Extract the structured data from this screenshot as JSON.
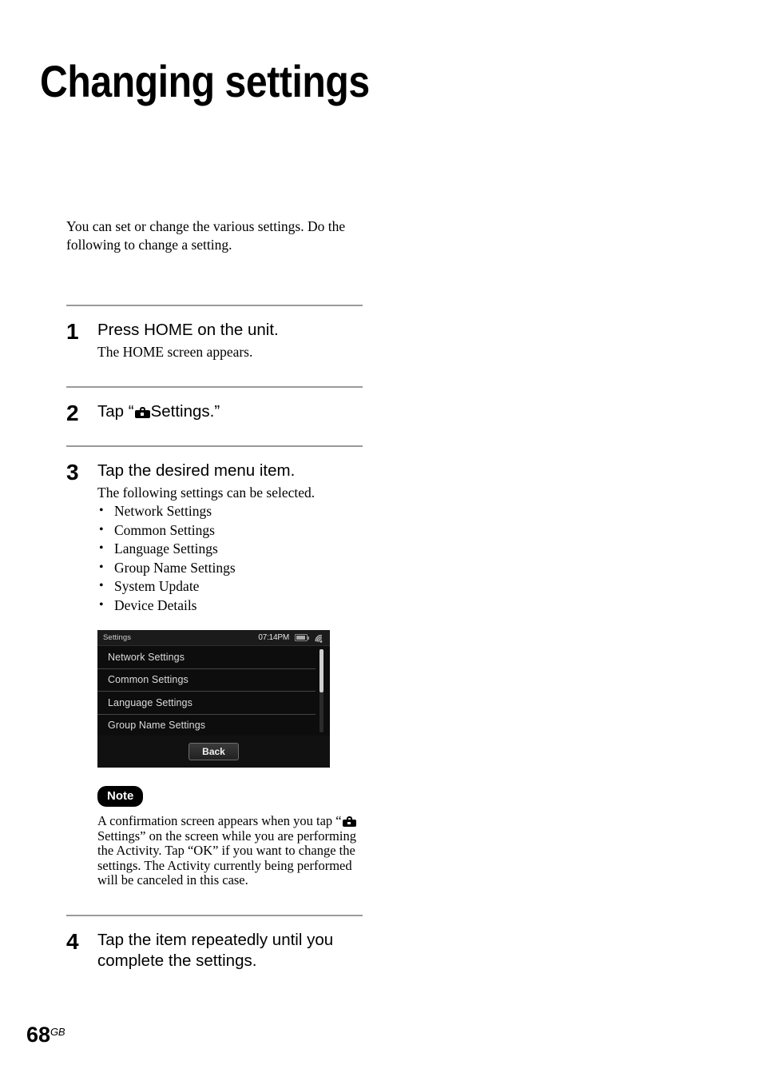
{
  "document": {
    "title": "Changing settings",
    "intro": "You can set or change the various settings. Do the following to change a setting.",
    "page_number": "68",
    "page_number_suffix": "GB"
  },
  "steps": [
    {
      "number": "1",
      "heading": "Press HOME on the unit.",
      "body": "The HOME screen appears."
    },
    {
      "number": "2",
      "heading_prefix": "Tap “",
      "heading_icon": "toolbox-icon",
      "heading_suffix": "Settings.”"
    },
    {
      "number": "3",
      "heading": "Tap the desired menu item.",
      "body": "The following settings can be selected.",
      "bullets": [
        "Network Settings",
        "Common Settings",
        "Language Settings",
        "Group Name Settings",
        "System Update",
        "Device Details"
      ]
    },
    {
      "number": "4",
      "heading": "Tap the item repeatedly until you complete the settings."
    }
  ],
  "device_screen": {
    "status_title": "Settings",
    "clock": "07:14PM",
    "battery_icon": "battery-icon",
    "wifi_icon": "wifi-signal-icon",
    "menu_items": [
      "Network Settings",
      "Common Settings",
      "Language Settings",
      "Group Name Settings"
    ],
    "back_label": "Back"
  },
  "note": {
    "badge": "Note",
    "text_part1": "A confirmation screen appears when you tap “",
    "icon": "toolbox-icon",
    "text_part2": " Settings” on the screen while you are performing the Activity. Tap “OK” if you want to change the settings. The Activity currently being performed will be canceled in this case."
  },
  "colors": {
    "rule": "#9a9a9a",
    "device_background": "#0d0d0d",
    "device_text": "#dcdcdc"
  }
}
